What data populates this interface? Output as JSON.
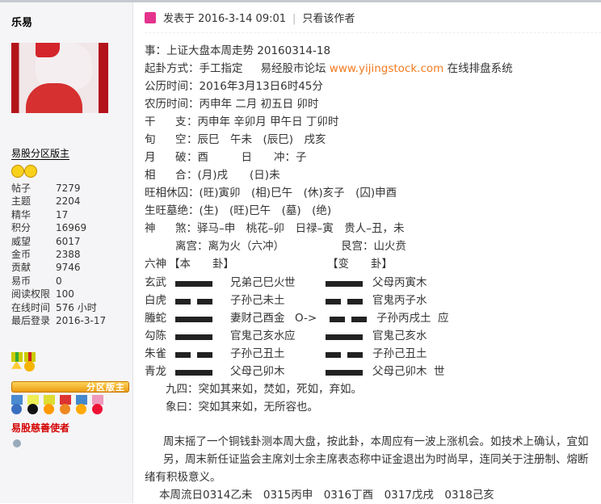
{
  "profile": {
    "username": "乐易",
    "rank": "易股分区版主",
    "badge": "分区版主",
    "charity": "易股慈善使者",
    "stats": [
      {
        "k": "帖子",
        "v": "7279"
      },
      {
        "k": "主题",
        "v": "2204"
      },
      {
        "k": "精华",
        "v": "17"
      },
      {
        "k": "积分",
        "v": "16969"
      },
      {
        "k": "威望",
        "v": "6017"
      },
      {
        "k": "金币",
        "v": "2388"
      },
      {
        "k": "贡献",
        "v": "9746"
      },
      {
        "k": "易币",
        "v": "0"
      },
      {
        "k": "阅读权限",
        "v": "100"
      },
      {
        "k": "在线时间",
        "v": "576 小时"
      },
      {
        "k": "最后登录",
        "v": "2016-3-17"
      }
    ]
  },
  "post": {
    "posted": "发表于 2016-3-14 09:01",
    "sep": "|",
    "author_only": "只看该作者",
    "l1": "事：上证大盘本周走势 20160314-18",
    "l2a": "起卦方式：手工指定",
    "l2b": "易经股市论坛",
    "l2link": "www.yijingstock.com",
    "l2c": "在线排盘系统",
    "l3": "公历时间：2016年3月13日6时45分",
    "l4": "农历时间：丙申年 二月 初五日 卯时",
    "rows": [
      {
        "k1": "干",
        "k2": "支",
        "v": "：丙申年 辛卯月 甲午日 丁卯时"
      },
      {
        "k1": "旬",
        "k2": "空",
        "v": "：辰巳　午未　(辰巳)　戌亥"
      },
      {
        "k1": "月",
        "k2": "破",
        "v": "：酉　　　日　　冲：子"
      },
      {
        "k1": "相",
        "k2": "合",
        "v": "：(月)戌　　(日)未"
      }
    ],
    "l9": "旺相休囚：(旺)寅卯　(相)巳午　(休)亥子　(囚)申酉",
    "l10": "生旺墓绝：(生)　(旺)巳午　(墓)　(绝)",
    "l11k1": "神",
    "l11": "煞：驿马–申　桃花–卯　日禄–寅　贵人–丑，未",
    "l12a": "离宫：离为火（六冲）",
    "l12b": "艮宫：山火贲",
    "liushen": "六神",
    "ben": "【本　　卦】",
    "bian": "【变　　卦】",
    "yao": [
      {
        "god": "玄武",
        "ben": "yang",
        "bt": "兄弟己巳火",
        "bm": "世",
        "bian": "yang",
        "vt": "父母丙寅木",
        "vm": ""
      },
      {
        "god": "白虎",
        "ben": "yin",
        "bt": "子孙己未土",
        "bm": "",
        "bian": "yin",
        "vt": "官鬼丙子水",
        "vm": ""
      },
      {
        "god": "螣蛇",
        "ben": "yang",
        "bt": "妻财己酉金",
        "bm": "",
        "move": "O->",
        "bian": "yin",
        "vt": "子孙丙戌土",
        "vm": "应"
      },
      {
        "god": "勾陈",
        "ben": "yang",
        "bt": "官鬼己亥水",
        "bm": "应",
        "bian": "yang",
        "vt": "官鬼己亥水",
        "vm": ""
      },
      {
        "god": "朱雀",
        "ben": "yin",
        "bt": "子孙己丑土",
        "bm": "",
        "bian": "yin",
        "vt": "子孙己丑土",
        "vm": ""
      },
      {
        "god": "青龙",
        "ben": "yang",
        "bt": "父母己卯木",
        "bm": "",
        "bian": "yang",
        "vt": "父母己卯木",
        "vm": "世"
      }
    ],
    "jiusi": "九四：突如其来如，焚如，死如，弃如。",
    "xiang": "象曰：突如其来如，无所容也。",
    "p1": "周末摇了一个铜钱卦测本周大盘，按此卦，本周应有一波上涨机会。如技术上确认，宜如",
    "p2": "另，周末新任证监会主席刘士余主席表态称中证金退出为时尚早，连同关于注册制、熔断",
    "p3": "绪有积极意义。",
    "p4": "本周流日0314乙未　0315丙申　0316丁酉　0317戊戌　0318己亥"
  },
  "colors": {
    "link": "#f37a1f",
    "sidebar": "#f5f5f7",
    "text": "#333333"
  }
}
